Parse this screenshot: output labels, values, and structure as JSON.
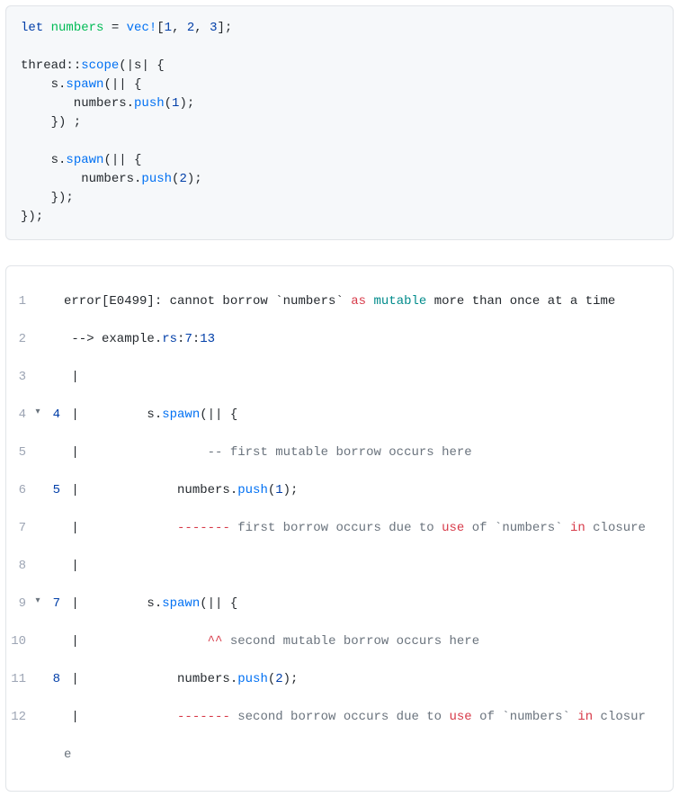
{
  "code1": {
    "l1a": "let",
    "l1b": "numbers",
    "l1c": "=",
    "l1d": "vec!",
    "l1e": "[",
    "l1f": "1",
    "l1g": ",",
    "l1h": "2",
    "l1i": ",",
    "l1j": "3",
    "l1k": "];",
    "l3a": "thread",
    "l3b": "::",
    "l3c": "scope",
    "l3d": "(|s| {",
    "l4a": "    s.",
    "l4b": "spawn",
    "l4c": "(|| {",
    "l5a": "       numbers.",
    "l5b": "push",
    "l5c": "(",
    "l5d": "1",
    "l5e": ");",
    "l6a": "    }) ;",
    "l8a": "    s.",
    "l8b": "spawn",
    "l8c": "(|| {",
    "l9a": "        numbers.",
    "l9b": "push",
    "l9c": "(",
    "l9d": "2",
    "l9e": ");",
    "l10a": "    });",
    "l11a": "});"
  },
  "err": {
    "ln1": "1",
    "ln2": "2",
    "ln3": "3",
    "ln4": "4",
    "ln5": "5",
    "ln6": "6",
    "ln7": "7",
    "ln8": "8",
    "ln9": "9",
    "ln10": "10",
    "ln11": "11",
    "ln12": "12",
    "sln4": "4",
    "sln5": "5",
    "sln7": "7",
    "sln8": "8",
    "fold4": "▾",
    "fold9": "▾",
    "l1": {
      "a": "error[E0499]: cannot borrow `numbers` ",
      "b": "as",
      "c": " ",
      "d": "mutable",
      "e": " more than once at a time"
    },
    "l2": {
      "a": " --> example.",
      "b": "rs",
      "c": ":",
      "d": "7",
      "e": ":",
      "f": "13"
    },
    "l3": " |",
    "l4": {
      "a": " |         s.",
      "b": "spawn",
      "c": "(|| {"
    },
    "l5": {
      "a": " |                 ",
      "b": "--",
      "c": " first mutable borrow occurs here"
    },
    "l6": {
      "a": " |             numbers.",
      "b": "push",
      "c": "(",
      "d": "1",
      "e": ");"
    },
    "l7": {
      "a": " |             ",
      "b": "-------",
      "c": " first borrow occurs due to ",
      "d": "use",
      "e": " of `numbers` ",
      "f": "in",
      "g": " closure"
    },
    "l8": " |",
    "l9": {
      "a": " |         s.",
      "b": "spawn",
      "c": "(|| {"
    },
    "l10": {
      "a": " |                 ",
      "b": "^^",
      "c": " second mutable borrow occurs here"
    },
    "l11": {
      "a": " |             numbers.",
      "b": "push",
      "c": "(",
      "d": "2",
      "e": ");"
    },
    "l12": {
      "a": " |             ",
      "b": "-------",
      "c": " second borrow occurs due to ",
      "d": "use",
      "e": " of `numbers` ",
      "f": "in",
      "g": " closur"
    },
    "l12cont": "e"
  }
}
